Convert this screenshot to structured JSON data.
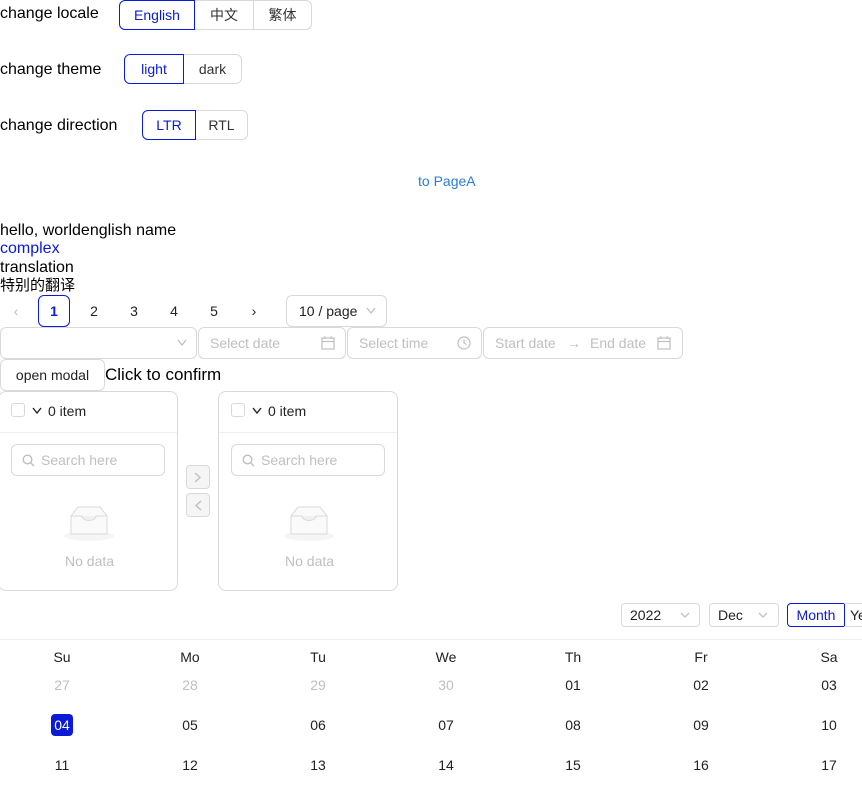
{
  "locale": {
    "label": "change locale",
    "options": [
      "English",
      "中文",
      "繁体"
    ],
    "selected": "English"
  },
  "theme": {
    "label": "change theme",
    "options": [
      "light",
      "dark"
    ],
    "selected": "light"
  },
  "direction": {
    "label": "change direction",
    "options": [
      "LTR",
      "RTL"
    ],
    "selected": "LTR"
  },
  "to_page_link": "to PageA",
  "texts": {
    "line1": "hello, worldenglish name",
    "line2": "complex",
    "line3": "translation",
    "line4": "特别的翻译"
  },
  "pagination": {
    "pages": [
      "1",
      "2",
      "3",
      "4",
      "5"
    ],
    "current": "1",
    "page_size": "10 / page",
    "prev_icon": "chevron-left-icon",
    "next_icon": "chevron-right-icon"
  },
  "pickers": {
    "date_placeholder": "Select date",
    "time_placeholder": "Select time",
    "range_start": "Start date",
    "range_end": "End date",
    "arrow": "→"
  },
  "modal": {
    "button": "open modal",
    "text": "Click to confirm"
  },
  "transfer": {
    "left": {
      "count": "0 item",
      "search_placeholder": "Search here",
      "empty": "No data"
    },
    "right": {
      "count": "0 item",
      "search_placeholder": "Search here",
      "empty": "No data"
    }
  },
  "calendar": {
    "year": "2022",
    "month": "Dec",
    "mode_options": [
      "Month",
      "Year"
    ],
    "mode_selected": "Month",
    "weekdays": [
      "Su",
      "Mo",
      "Tu",
      "We",
      "Th",
      "Fr",
      "Sa"
    ],
    "rows": [
      [
        "27",
        "28",
        "29",
        "30",
        "01",
        "02",
        "03"
      ],
      [
        "04",
        "05",
        "06",
        "07",
        "08",
        "09",
        "10"
      ],
      [
        "11",
        "12",
        "13",
        "14",
        "15",
        "16",
        "17"
      ]
    ],
    "today": "04",
    "accent": "#0a1ad6"
  }
}
